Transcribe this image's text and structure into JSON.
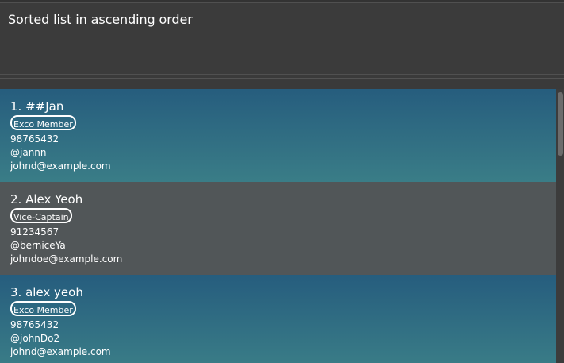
{
  "result": {
    "message": "Sorted list in ascending order"
  },
  "persons": [
    {
      "index_name": "1. ##Jan",
      "tag": "Exco Member",
      "phone": "98765432",
      "handle": "@jannn",
      "email": "johnd@example.com"
    },
    {
      "index_name": "2. Alex Yeoh",
      "tag": "Vice-Captain",
      "phone": "91234567",
      "handle": "@berniceYa",
      "email": "johndoe@example.com"
    },
    {
      "index_name": "3. alex yeoh",
      "tag": "Exco Member",
      "phone": "98765432",
      "handle": "@johnDo2",
      "email": "johnd@example.com"
    }
  ]
}
